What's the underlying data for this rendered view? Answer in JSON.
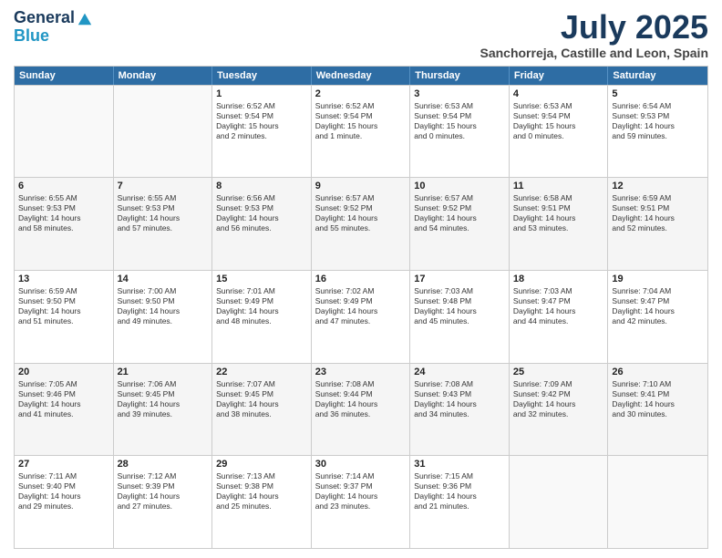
{
  "header": {
    "logo_line1": "General",
    "logo_line2": "Blue",
    "title": "July 2025",
    "subtitle": "Sanchorreja, Castille and Leon, Spain"
  },
  "weekdays": [
    "Sunday",
    "Monday",
    "Tuesday",
    "Wednesday",
    "Thursday",
    "Friday",
    "Saturday"
  ],
  "rows": [
    [
      {
        "day": "",
        "lines": []
      },
      {
        "day": "",
        "lines": []
      },
      {
        "day": "1",
        "lines": [
          "Sunrise: 6:52 AM",
          "Sunset: 9:54 PM",
          "Daylight: 15 hours",
          "and 2 minutes."
        ]
      },
      {
        "day": "2",
        "lines": [
          "Sunrise: 6:52 AM",
          "Sunset: 9:54 PM",
          "Daylight: 15 hours",
          "and 1 minute."
        ]
      },
      {
        "day": "3",
        "lines": [
          "Sunrise: 6:53 AM",
          "Sunset: 9:54 PM",
          "Daylight: 15 hours",
          "and 0 minutes."
        ]
      },
      {
        "day": "4",
        "lines": [
          "Sunrise: 6:53 AM",
          "Sunset: 9:54 PM",
          "Daylight: 15 hours",
          "and 0 minutes."
        ]
      },
      {
        "day": "5",
        "lines": [
          "Sunrise: 6:54 AM",
          "Sunset: 9:53 PM",
          "Daylight: 14 hours",
          "and 59 minutes."
        ]
      }
    ],
    [
      {
        "day": "6",
        "lines": [
          "Sunrise: 6:55 AM",
          "Sunset: 9:53 PM",
          "Daylight: 14 hours",
          "and 58 minutes."
        ]
      },
      {
        "day": "7",
        "lines": [
          "Sunrise: 6:55 AM",
          "Sunset: 9:53 PM",
          "Daylight: 14 hours",
          "and 57 minutes."
        ]
      },
      {
        "day": "8",
        "lines": [
          "Sunrise: 6:56 AM",
          "Sunset: 9:53 PM",
          "Daylight: 14 hours",
          "and 56 minutes."
        ]
      },
      {
        "day": "9",
        "lines": [
          "Sunrise: 6:57 AM",
          "Sunset: 9:52 PM",
          "Daylight: 14 hours",
          "and 55 minutes."
        ]
      },
      {
        "day": "10",
        "lines": [
          "Sunrise: 6:57 AM",
          "Sunset: 9:52 PM",
          "Daylight: 14 hours",
          "and 54 minutes."
        ]
      },
      {
        "day": "11",
        "lines": [
          "Sunrise: 6:58 AM",
          "Sunset: 9:51 PM",
          "Daylight: 14 hours",
          "and 53 minutes."
        ]
      },
      {
        "day": "12",
        "lines": [
          "Sunrise: 6:59 AM",
          "Sunset: 9:51 PM",
          "Daylight: 14 hours",
          "and 52 minutes."
        ]
      }
    ],
    [
      {
        "day": "13",
        "lines": [
          "Sunrise: 6:59 AM",
          "Sunset: 9:50 PM",
          "Daylight: 14 hours",
          "and 51 minutes."
        ]
      },
      {
        "day": "14",
        "lines": [
          "Sunrise: 7:00 AM",
          "Sunset: 9:50 PM",
          "Daylight: 14 hours",
          "and 49 minutes."
        ]
      },
      {
        "day": "15",
        "lines": [
          "Sunrise: 7:01 AM",
          "Sunset: 9:49 PM",
          "Daylight: 14 hours",
          "and 48 minutes."
        ]
      },
      {
        "day": "16",
        "lines": [
          "Sunrise: 7:02 AM",
          "Sunset: 9:49 PM",
          "Daylight: 14 hours",
          "and 47 minutes."
        ]
      },
      {
        "day": "17",
        "lines": [
          "Sunrise: 7:03 AM",
          "Sunset: 9:48 PM",
          "Daylight: 14 hours",
          "and 45 minutes."
        ]
      },
      {
        "day": "18",
        "lines": [
          "Sunrise: 7:03 AM",
          "Sunset: 9:47 PM",
          "Daylight: 14 hours",
          "and 44 minutes."
        ]
      },
      {
        "day": "19",
        "lines": [
          "Sunrise: 7:04 AM",
          "Sunset: 9:47 PM",
          "Daylight: 14 hours",
          "and 42 minutes."
        ]
      }
    ],
    [
      {
        "day": "20",
        "lines": [
          "Sunrise: 7:05 AM",
          "Sunset: 9:46 PM",
          "Daylight: 14 hours",
          "and 41 minutes."
        ]
      },
      {
        "day": "21",
        "lines": [
          "Sunrise: 7:06 AM",
          "Sunset: 9:45 PM",
          "Daylight: 14 hours",
          "and 39 minutes."
        ]
      },
      {
        "day": "22",
        "lines": [
          "Sunrise: 7:07 AM",
          "Sunset: 9:45 PM",
          "Daylight: 14 hours",
          "and 38 minutes."
        ]
      },
      {
        "day": "23",
        "lines": [
          "Sunrise: 7:08 AM",
          "Sunset: 9:44 PM",
          "Daylight: 14 hours",
          "and 36 minutes."
        ]
      },
      {
        "day": "24",
        "lines": [
          "Sunrise: 7:08 AM",
          "Sunset: 9:43 PM",
          "Daylight: 14 hours",
          "and 34 minutes."
        ]
      },
      {
        "day": "25",
        "lines": [
          "Sunrise: 7:09 AM",
          "Sunset: 9:42 PM",
          "Daylight: 14 hours",
          "and 32 minutes."
        ]
      },
      {
        "day": "26",
        "lines": [
          "Sunrise: 7:10 AM",
          "Sunset: 9:41 PM",
          "Daylight: 14 hours",
          "and 30 minutes."
        ]
      }
    ],
    [
      {
        "day": "27",
        "lines": [
          "Sunrise: 7:11 AM",
          "Sunset: 9:40 PM",
          "Daylight: 14 hours",
          "and 29 minutes."
        ]
      },
      {
        "day": "28",
        "lines": [
          "Sunrise: 7:12 AM",
          "Sunset: 9:39 PM",
          "Daylight: 14 hours",
          "and 27 minutes."
        ]
      },
      {
        "day": "29",
        "lines": [
          "Sunrise: 7:13 AM",
          "Sunset: 9:38 PM",
          "Daylight: 14 hours",
          "and 25 minutes."
        ]
      },
      {
        "day": "30",
        "lines": [
          "Sunrise: 7:14 AM",
          "Sunset: 9:37 PM",
          "Daylight: 14 hours",
          "and 23 minutes."
        ]
      },
      {
        "day": "31",
        "lines": [
          "Sunrise: 7:15 AM",
          "Sunset: 9:36 PM",
          "Daylight: 14 hours",
          "and 21 minutes."
        ]
      },
      {
        "day": "",
        "lines": []
      },
      {
        "day": "",
        "lines": []
      }
    ]
  ]
}
